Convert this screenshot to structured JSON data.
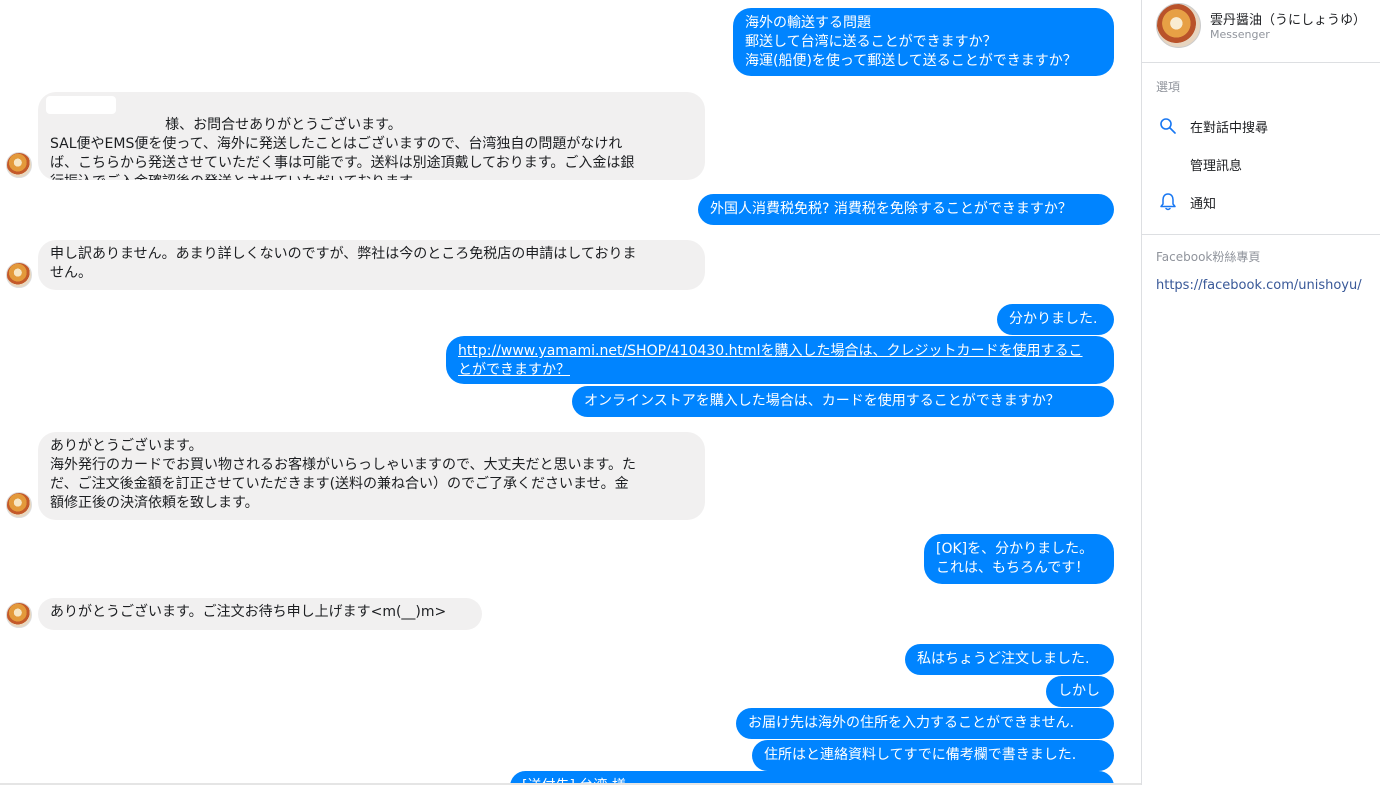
{
  "conversation": {
    "messages": [
      {
        "from": "me",
        "text": "海外の輸送する問題\n郵送して台湾に送ることができますか？\n海運(船便)を使って郵送して送ることができますか？"
      },
      {
        "from": "them",
        "text": "　　　　　　 様、お問合せありがとうございます。\nSAL便やEMS便を使って、海外に発送したことはございますので、台湾独自の問題がなけれ\nば、こちらから発送させていただく事は可能です。送料は別途頂戴しております。ご入金は銀\n行振込でご入金確認後の発送とさせていただいております。"
      },
      {
        "from": "me",
        "text": "外国人消費税免税? 消費税を免除することができますか？"
      },
      {
        "from": "them",
        "text": "申し訳ありません。あまり詳しくないのですが、弊社は今のところ免税店の申請はしておりま\nせん。"
      },
      {
        "from": "me",
        "text": "分かりました."
      },
      {
        "from": "me",
        "text": "http://www.yamami.net/SHOP/410430.htmlを購入した場合は、クレジットカードを使用するこ\nとができますか？"
      },
      {
        "from": "me",
        "text": "オンラインストアを購入した場合は、カードを使用することができますか？"
      },
      {
        "from": "them",
        "text": "ありがとうございます。\n海外発行のカードでお買い物されるお客様がいらっしゃいますので、大丈夫だと思います。た\nだ、ご注文後金額を訂正させていただきます(送料の兼ね合い）のでご了承くださいませ。金\n額修正後の決済依頼を致します。"
      },
      {
        "from": "me",
        "text": "[OK]を、分かりました。\nこれは、もちろんです！"
      },
      {
        "from": "them",
        "text": "ありがとうございます。ご注文お待ち申し上げます<m(__)m>"
      },
      {
        "from": "me",
        "text": "私はちょうど注文しました."
      },
      {
        "from": "me",
        "text": "しかし"
      },
      {
        "from": "me",
        "text": "お届け先は海外の住所を入力することができません."
      },
      {
        "from": "me",
        "text": "住所はと連絡資料してすでに備考欄で書きました."
      },
      {
        "from": "me",
        "text": "[送付先] 台湾 様"
      }
    ]
  },
  "sidebar": {
    "contact_name": "雲丹醤油（うにしょうゆ）",
    "contact_subtitle": "Messenger",
    "options_title": "選項",
    "search_label": "在對話中搜尋",
    "manage_label": "管理訊息",
    "notify_label": "通知",
    "fanpage_title": "Facebook粉絲專頁",
    "fanpage_url": "https://facebook.com/unishoyu/"
  },
  "colors": {
    "outgoing_bubble": "#0084ff",
    "incoming_bubble": "#f1f0f0",
    "link": "#385898"
  },
  "icons": {
    "search": "search-icon",
    "notify": "bell-icon"
  }
}
